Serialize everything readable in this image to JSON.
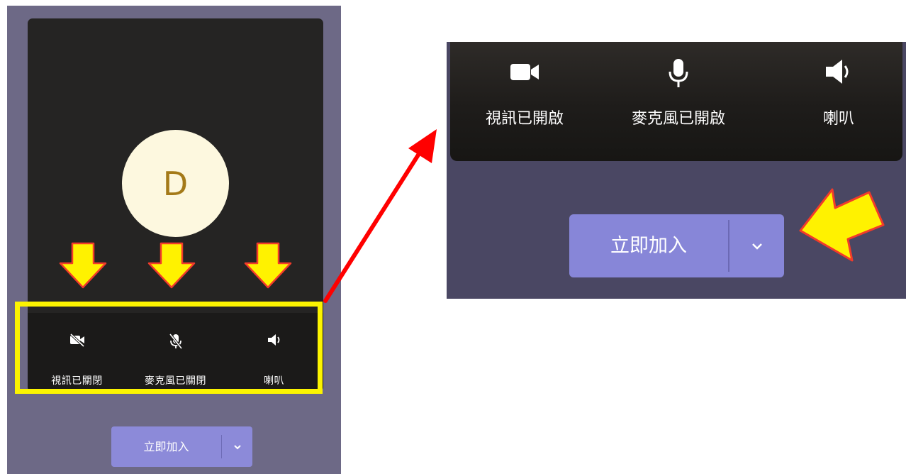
{
  "preview": {
    "avatar_initial": "D",
    "controls": [
      {
        "icon": "video-off-icon",
        "label": "視訊已關閉"
      },
      {
        "icon": "mic-off-icon",
        "label": "麥克風已關閉"
      },
      {
        "icon": "speaker-icon",
        "label": "喇叭"
      }
    ],
    "join_label": "立即加入"
  },
  "zoom": {
    "controls": [
      {
        "icon": "video-on-icon",
        "label": "視訊已開啟"
      },
      {
        "icon": "mic-on-icon",
        "label": "麥克風已開啟"
      },
      {
        "icon": "speaker-icon",
        "label": "喇叭"
      }
    ],
    "join_label": "立即加入"
  },
  "colors": {
    "panel_bg": "#6d6986",
    "preview_bg": "#252423",
    "avatar_bg": "#fdf8df",
    "avatar_text": "#a47a18",
    "join_button": "#8786d8",
    "highlight": "#fcf400",
    "pointer_arrow": "#ff0000"
  }
}
